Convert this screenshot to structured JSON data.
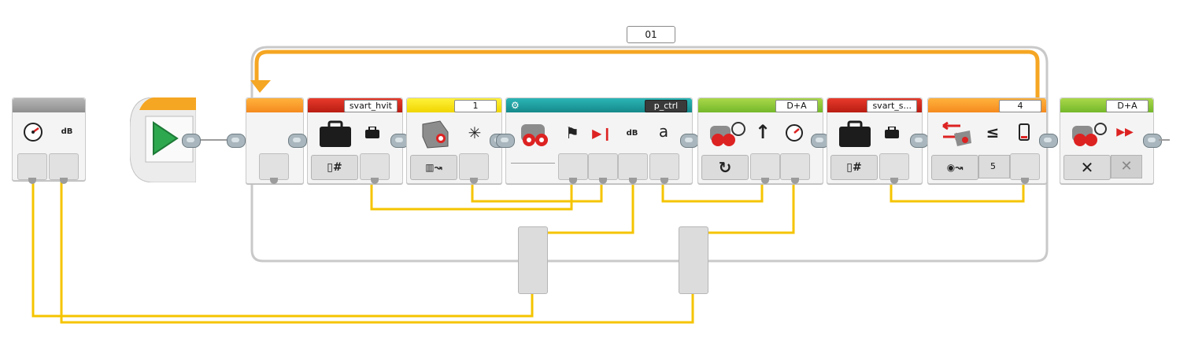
{
  "colors": {
    "wire": "#f5c400",
    "loop_orange": "#f5a623",
    "start_green": "#2ea84f"
  },
  "loop": {
    "label": "01"
  },
  "sound_block": {
    "unit_label": "dB",
    "icon": "speedometer-icon"
  },
  "start_block": {
    "icon": "play-icon"
  },
  "blocks": [
    {
      "id": "loop_start",
      "color": "orange"
    },
    {
      "id": "var1",
      "name": "svart_hvit",
      "icon": "briefcase-icon",
      "mode": "book-number-icon"
    },
    {
      "id": "color_sensor",
      "port": "1",
      "icon": "color-sensor-icon",
      "mode": "calibrate-icon"
    },
    {
      "id": "myblock",
      "name": "p_ctrl",
      "icon": "motor-icon",
      "params": [
        "checkered-flag-icon",
        "play-stop-icon",
        "dB",
        "a"
      ]
    },
    {
      "id": "steering",
      "ports": "D+A",
      "icon": "steering-motor-icon",
      "mode": "rotate-icon"
    },
    {
      "id": "var2",
      "name": "svart_s...",
      "icon": "briefcase-icon",
      "mode": "book-number-icon"
    },
    {
      "id": "compare",
      "port": "4",
      "icon": "compare-icon",
      "op": "≤",
      "value": "5"
    },
    {
      "id": "stop_motor",
      "ports": "D+A",
      "icon": "motor-stop-icon",
      "mode": "stop-icon"
    }
  ]
}
